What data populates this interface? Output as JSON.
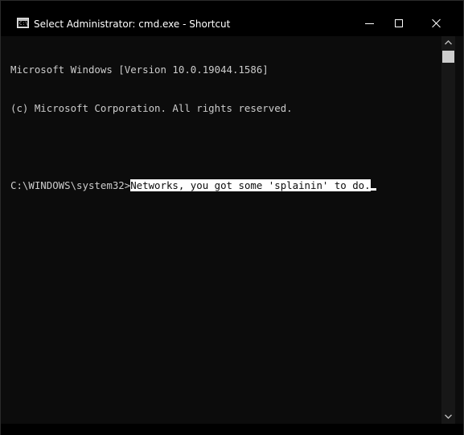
{
  "window": {
    "title": "Select Administrator: cmd.exe - Shortcut",
    "icon": "cmd-icon",
    "icon_prompt": "C:\\"
  },
  "caption_buttons": {
    "minimize": "minimize-icon",
    "maximize": "maximize-icon",
    "close": "close-icon"
  },
  "console": {
    "lines": [
      "Microsoft Windows [Version 10.0.19044.1586]",
      "(c) Microsoft Corporation. All rights reserved."
    ],
    "prompt": "C:\\WINDOWS\\system32>",
    "selected_text": "Networks, you got some 'splainin' to do.",
    "text_color": "#cccccc",
    "background_color": "#0c0c0c"
  },
  "scrollbar": {
    "up_icon": "scroll-up-arrow-icon",
    "down_icon": "scroll-down-arrow-icon",
    "position": 0
  }
}
